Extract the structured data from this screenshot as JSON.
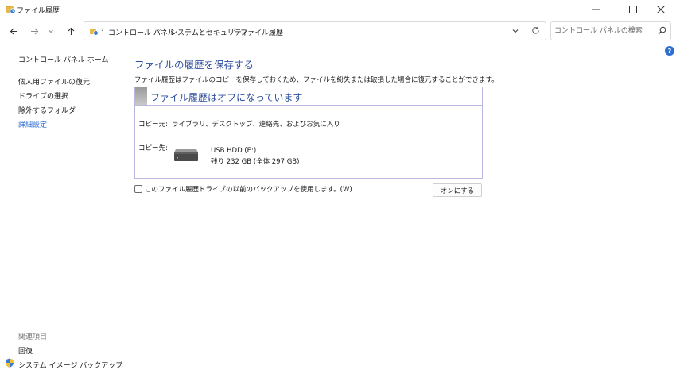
{
  "window": {
    "title": "ファイル履歴"
  },
  "nav": {
    "breadcrumb": [
      "コントロール パネル",
      "システムとセキュリティ",
      "ファイル履歴"
    ],
    "search_placeholder": "コントロール パネルの検索"
  },
  "sidebar": {
    "home": "コントロール パネル ホーム",
    "links": [
      "個人用ファイルの復元",
      "ドライブの選択",
      "除外するフォルダー",
      "詳細設定"
    ],
    "related_heading": "関連項目",
    "related_links": [
      "回復",
      "システム イメージ バックアップ"
    ]
  },
  "main": {
    "title": "ファイルの履歴を保存する",
    "description": "ファイル履歴はファイルのコピーを保存しておくため、ファイルを紛失または破損した場合に復元することができます。",
    "status_title": "ファイル履歴はオフになっています",
    "copy_source_label": "コピー元:",
    "copy_source_value": "ライブラリ、デスクトップ、連絡先、およびお気に入り",
    "copy_dest_label": "コピー先:",
    "drive_name": "USB HDD (E:)",
    "drive_space": "残り 232 GB (全体 297 GB)",
    "checkbox_label": "このファイル履歴ドライブの以前のバックアップを使用します。(W)",
    "turn_on_button": "オンにする"
  },
  "colors": {
    "accent_blue": "#2f4f9e",
    "link_blue": "#2b6bd6",
    "box_border": "#b8b8de"
  }
}
